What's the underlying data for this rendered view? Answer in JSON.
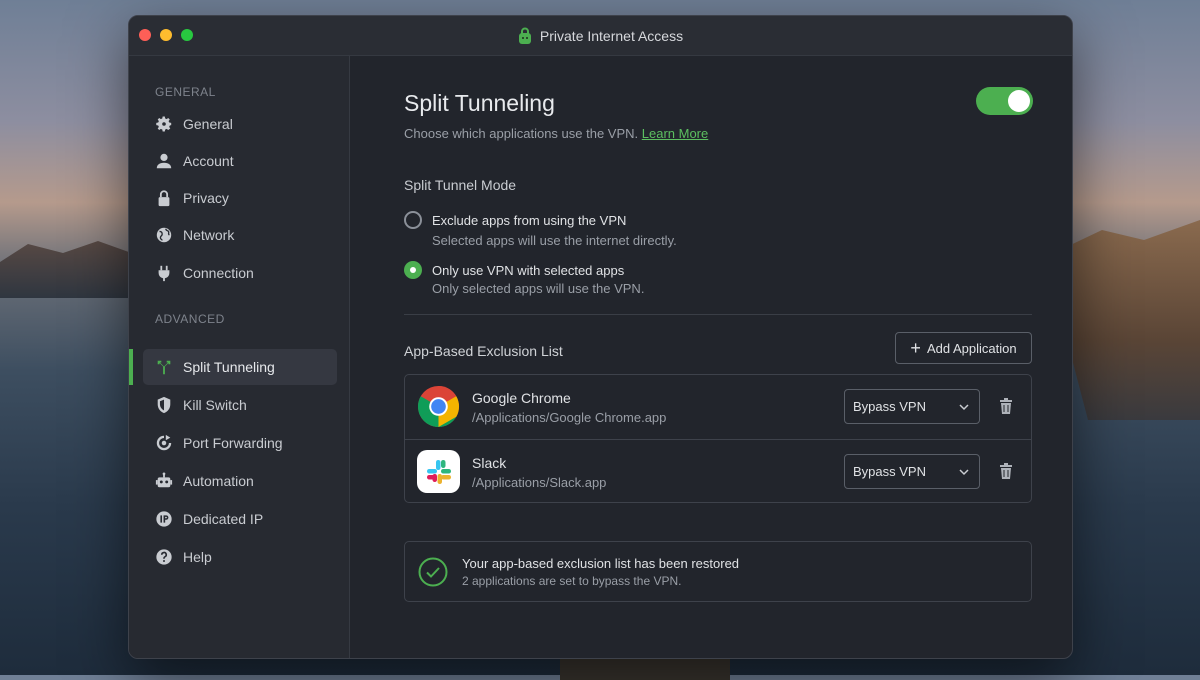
{
  "window": {
    "title": "Private Internet Access"
  },
  "sidebar": {
    "general_label": "GENERAL",
    "advanced_label": "ADVANCED",
    "general_items": [
      {
        "label": "General",
        "icon": "gear-icon"
      },
      {
        "label": "Account",
        "icon": "user-icon"
      },
      {
        "label": "Privacy",
        "icon": "lock-icon"
      },
      {
        "label": "Network",
        "icon": "globe-icon"
      },
      {
        "label": "Connection",
        "icon": "plug-icon"
      }
    ],
    "advanced_items": [
      {
        "label": "Split Tunneling",
        "icon": "split-tunnel-icon",
        "active": true
      },
      {
        "label": "Kill Switch",
        "icon": "shield-icon"
      },
      {
        "label": "Port Forwarding",
        "icon": "port-forward-icon"
      },
      {
        "label": "Automation",
        "icon": "robot-icon"
      },
      {
        "label": "Dedicated IP",
        "icon": "ip-icon"
      },
      {
        "label": "Help",
        "icon": "help-icon"
      }
    ]
  },
  "main": {
    "title": "Split Tunneling",
    "subtitle": "Choose which applications use the VPN.",
    "learn_more": "Learn More",
    "enabled": true,
    "mode_title": "Split Tunnel Mode",
    "options": [
      {
        "label": "Exclude apps from using the VPN",
        "desc": "Selected apps will use the internet directly.",
        "selected": false
      },
      {
        "label": "Only use VPN with selected apps",
        "desc": "Only selected apps will use the VPN.",
        "selected": true
      }
    ],
    "list_title": "App-Based Exclusion List",
    "add_button": "Add Application",
    "apps": [
      {
        "name": "Google Chrome",
        "path": "/Applications/Google Chrome.app",
        "mode": "Bypass VPN",
        "icon": "chrome-icon"
      },
      {
        "name": "Slack",
        "path": "/Applications/Slack.app",
        "mode": "Bypass VPN",
        "icon": "slack-icon"
      }
    ],
    "notice": {
      "title": "Your app-based exclusion list has been restored",
      "desc": "2 applications are set to bypass the VPN."
    }
  },
  "colors": {
    "accent": "#4caf50",
    "background": "#22252c",
    "sidebar": "#272a31"
  }
}
